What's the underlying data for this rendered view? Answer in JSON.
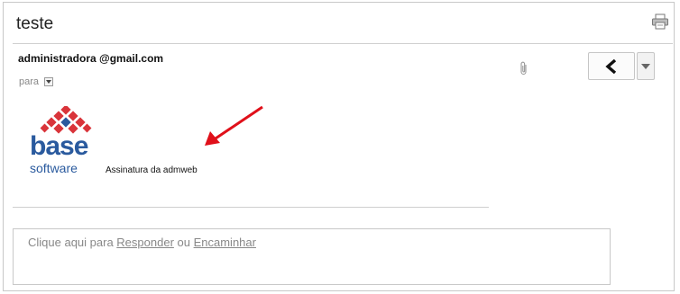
{
  "email": {
    "subject": "teste",
    "sender": "administradora @gmail.com",
    "recipient_label": "para"
  },
  "body": {
    "logo_text_1": "base",
    "logo_text_2": "software",
    "signature": "Assinatura da admweb"
  },
  "reply_prompt": {
    "prefix": "Clique aqui para ",
    "reply_link": "Responder",
    "separator": " ou ",
    "forward_link": "Encaminhar"
  },
  "icons": {
    "print": "printer-icon",
    "attachment": "paperclip-icon",
    "reply": "reply-arrow-icon",
    "more": "chevron-down-icon",
    "recipient_dropdown": "small-triangle-icon"
  },
  "colors": {
    "logo_blue": "#2a5a9e",
    "logo_red": "#d9343a",
    "arrow_red": "#e0101a"
  }
}
